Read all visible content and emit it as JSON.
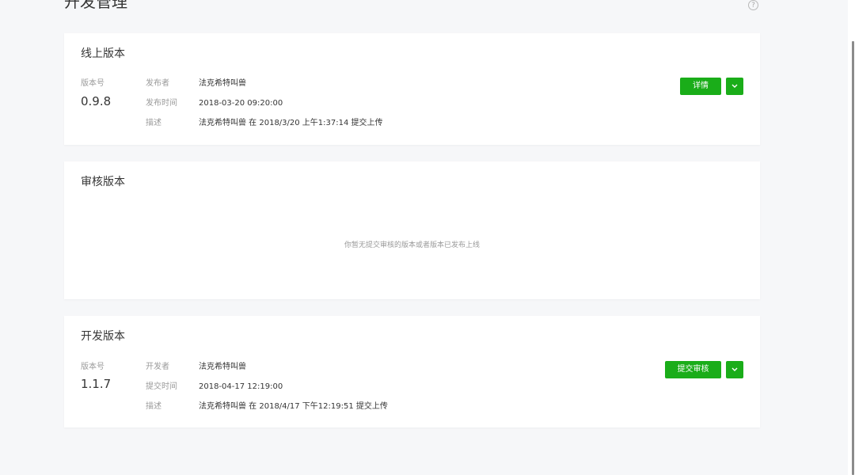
{
  "page": {
    "title": "开发管理",
    "help_icon_glyph": "?"
  },
  "online": {
    "title": "线上版本",
    "version_label": "版本号",
    "version": "0.9.8",
    "rows": [
      {
        "label": "发布者",
        "value": "法克希特叫兽"
      },
      {
        "label": "发布时间",
        "value": "2018-03-20 09:20:00"
      },
      {
        "label": "描述",
        "value": "法克希特叫兽 在 2018/3/20 上午1:37:14 提交上传"
      }
    ],
    "primary_button": "详情"
  },
  "review": {
    "title": "审核版本",
    "empty_text": "你暂无提交审核的版本或者版本已发布上线"
  },
  "dev": {
    "title": "开发版本",
    "version_label": "版本号",
    "version": "1.1.7",
    "rows": [
      {
        "label": "开发者",
        "value": "法克希特叫兽"
      },
      {
        "label": "提交时间",
        "value": "2018-04-17 12:19:00"
      },
      {
        "label": "描述",
        "value": "法克希特叫兽 在 2018/4/17 下午12:19:51 提交上传"
      }
    ],
    "primary_button": "提交审核"
  },
  "colors": {
    "accent": "#1aad19",
    "background": "#f6f7f9",
    "card": "#ffffff"
  }
}
